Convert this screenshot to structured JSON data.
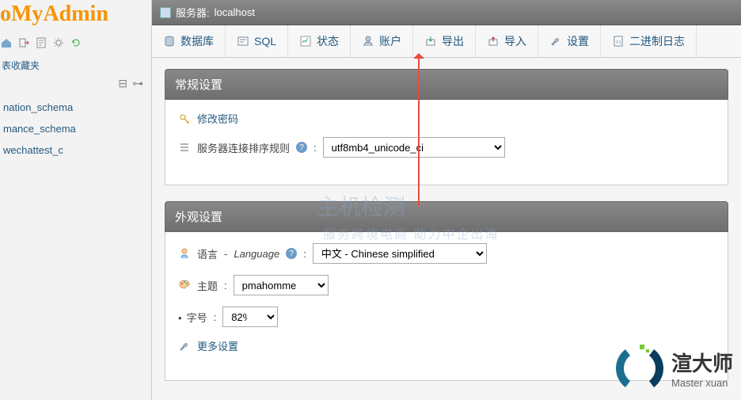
{
  "logo": {
    "part1": "o",
    "part2": "My",
    "part3": "Admin"
  },
  "sidebar": {
    "favorites_label": "表收藏夹",
    "databases": [
      "nation_schema",
      "mance_schema",
      "wechattest_c"
    ]
  },
  "breadcrumb": {
    "server_label": "服务器:",
    "server_value": "localhost"
  },
  "tabs": [
    {
      "key": "databases",
      "label": "数据库"
    },
    {
      "key": "sql",
      "label": "SQL"
    },
    {
      "key": "status",
      "label": "状态"
    },
    {
      "key": "accounts",
      "label": "账户"
    },
    {
      "key": "export",
      "label": "导出"
    },
    {
      "key": "import",
      "label": "导入"
    },
    {
      "key": "settings",
      "label": "设置"
    },
    {
      "key": "binlog",
      "label": "二进制日志"
    }
  ],
  "general": {
    "title": "常规设置",
    "change_password": "修改密码",
    "collation_label": "服务器连接排序规则",
    "collation_value": "utf8mb4_unicode_ci"
  },
  "appearance": {
    "title": "外观设置",
    "language_label": "语言",
    "language_italic": "Language",
    "language_value": "中文 - Chinese simplified",
    "theme_label": "主题",
    "theme_value": "pmahomme",
    "font_label": "字号",
    "font_value": "82%",
    "more_settings": "更多设置"
  },
  "watermark": {
    "bg1": "主机检测",
    "bg2": "服务跨境电商 助力中企出海",
    "brand_big": "渲大师",
    "brand_small": "Master xuan"
  }
}
